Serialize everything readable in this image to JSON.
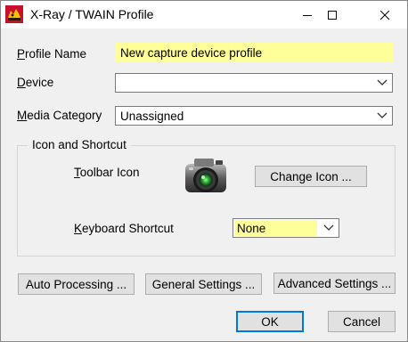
{
  "window": {
    "title": "X-Ray / TWAIN  Profile",
    "app_icon": "x-ray-app-icon",
    "controls": [
      "minimize-icon",
      "maximize-icon",
      "close-icon"
    ]
  },
  "form": {
    "profile_name_label": "Profile Name",
    "profile_name_value": "New capture device profile",
    "device_label": "Device",
    "device_value": "",
    "media_category_label": "Media Category",
    "media_category_value": "Unassigned"
  },
  "group": {
    "title": "Icon and Shortcut",
    "toolbar_icon_label": "Toolbar Icon",
    "toolbar_icon": "camera-icon",
    "change_icon_label": "Change Icon ...",
    "keyboard_shortcut_label": "Keyboard Shortcut",
    "keyboard_shortcut_value": "None"
  },
  "buttons": {
    "auto_processing": "Auto Processing ...",
    "general_settings": "General Settings ...",
    "advanced_settings": "Advanced Settings ...",
    "ok": "OK",
    "cancel": "Cancel"
  },
  "colors": {
    "highlight_field": "#ffff99",
    "accent": "#0078d7"
  }
}
